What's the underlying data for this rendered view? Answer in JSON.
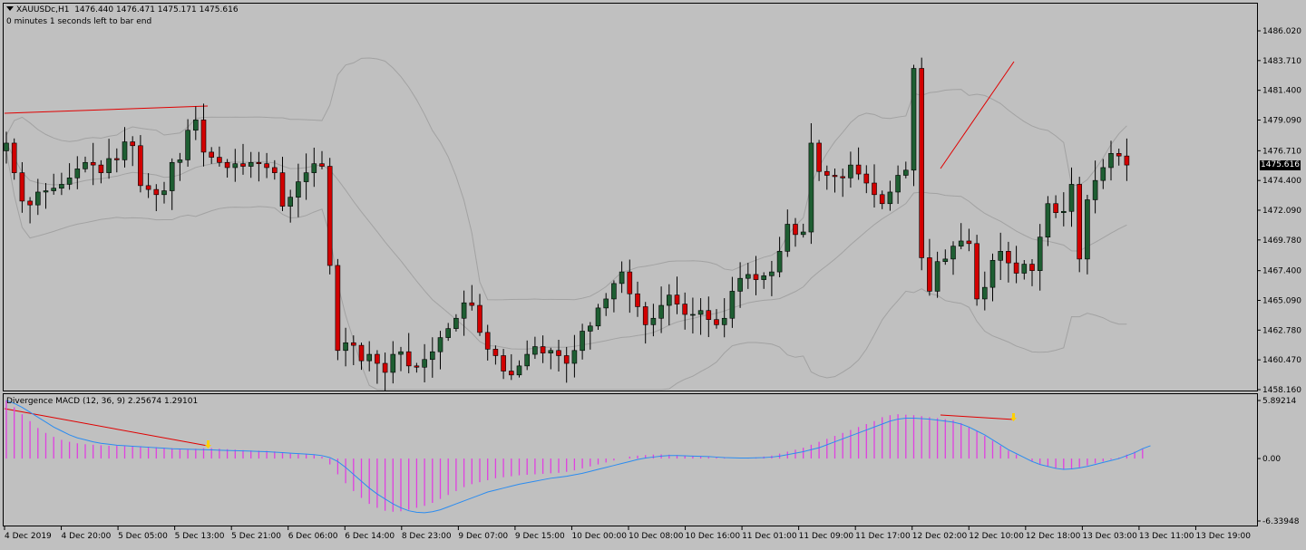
{
  "header": {
    "symbol": "XAUUSDc,H1",
    "ohlc": "1476.440 1476.471 1475.171 1475.616",
    "timer": "0 minutes 1 seconds left to bar end",
    "dropdown_icon": "triangle-down-icon"
  },
  "colors": {
    "background": "#c0c0c0",
    "bull_candle": "#1e5e32",
    "bear_candle": "#d20000",
    "bands": "#a2a2a2",
    "trendline": "#e00000",
    "macd_hist": "#e040e0",
    "macd_signal": "#2b8cf0",
    "arrow": "#ffd000"
  },
  "chart_data": [
    {
      "type": "candlestick",
      "title": "XAUUSDc,H1",
      "current_price": "1475.616",
      "ylim": [
        1458.16,
        1487.5
      ],
      "y_tick_labels": [
        "1486.020",
        "1483.710",
        "1481.400",
        "1479.090",
        "1476.710",
        "1474.400",
        "1472.090",
        "1469.780",
        "1467.400",
        "1465.090",
        "1462.780",
        "1460.470",
        "1458.160"
      ],
      "x_tick_labels": [
        "4 Dec 2019",
        "4 Dec 20:00",
        "5 Dec 05:00",
        "5 Dec 13:00",
        "5 Dec 21:00",
        "6 Dec 06:00",
        "6 Dec 14:00",
        "8 Dec 23:00",
        "9 Dec 07:00",
        "9 Dec 15:00",
        "10 Dec 00:00",
        "10 Dec 08:00",
        "10 Dec 16:00",
        "11 Dec 01:00",
        "11 Dec 09:00",
        "11 Dec 17:00",
        "12 Dec 02:00",
        "12 Dec 10:00",
        "12 Dec 18:00",
        "13 Dec 03:00",
        "13 Dec 11:00",
        "13 Dec 19:00"
      ],
      "series_close": [
        1477.3,
        1475.0,
        1472.8,
        1472.5,
        1473.5,
        1473.6,
        1473.8,
        1474.1,
        1474.6,
        1475.3,
        1475.8,
        1475.6,
        1475.0,
        1476.1,
        1476.0,
        1477.4,
        1477.1,
        1474.0,
        1473.7,
        1473.3,
        1473.6,
        1475.8,
        1476.0,
        1478.3,
        1479.1,
        1476.6,
        1476.2,
        1475.8,
        1475.4,
        1475.7,
        1475.5,
        1475.8,
        1475.7,
        1475.4,
        1475.0,
        1472.4,
        1473.1,
        1474.3,
        1475.0,
        1475.7,
        1475.5,
        1467.8,
        1461.2,
        1461.8,
        1461.6,
        1460.4,
        1460.9,
        1460.2,
        1459.5,
        1460.9,
        1461.1,
        1460.0,
        1459.9,
        1460.5,
        1461.1,
        1462.2,
        1462.9,
        1463.7,
        1464.9,
        1464.7,
        1462.6,
        1461.3,
        1460.8,
        1459.6,
        1459.3,
        1460.0,
        1460.9,
        1461.5,
        1461.0,
        1461.2,
        1460.8,
        1460.2,
        1461.2,
        1462.7,
        1463.1,
        1464.5,
        1465.2,
        1466.4,
        1467.3,
        1465.6,
        1464.6,
        1463.2,
        1463.7,
        1464.7,
        1465.5,
        1464.8,
        1464.0,
        1464.0,
        1464.3,
        1463.6,
        1463.2,
        1463.7,
        1465.8,
        1466.8,
        1467.1,
        1466.7,
        1467.0,
        1467.3,
        1468.9,
        1471.0,
        1470.2,
        1470.4,
        1477.3,
        1475.1,
        1474.8,
        1474.7,
        1474.6,
        1475.6,
        1474.9,
        1474.2,
        1473.3,
        1472.6,
        1473.5,
        1474.8,
        1475.2,
        1483.1,
        1468.4,
        1465.8,
        1468.1,
        1468.3,
        1469.3,
        1469.7,
        1469.5,
        1465.2,
        1466.1,
        1468.2,
        1468.9,
        1468.0,
        1467.2,
        1467.9,
        1467.4,
        1470.0,
        1472.6,
        1471.9,
        1472.0,
        1474.1,
        1468.3,
        1472.9,
        1474.4,
        1475.4,
        1476.5,
        1476.3,
        1475.6
      ],
      "macd_histogram_range": [
        -6.33948,
        5.89214
      ]
    },
    {
      "type": "bar+line",
      "title": "Divergence MACD (12, 36, 9) 2.25674 1.29101",
      "ylim": [
        -6.33948,
        5.89214
      ],
      "y_tick_labels": [
        "5.89214",
        "0.00",
        "-6.33948"
      ],
      "series": [
        {
          "name": "MACD",
          "values": [
            5.9,
            5.2,
            4.5,
            3.8,
            3.1,
            2.6,
            2.2,
            1.9,
            1.7,
            1.55,
            1.45,
            1.4,
            1.35,
            1.3,
            1.3,
            1.3,
            1.28,
            1.25,
            1.2,
            1.15,
            1.1,
            1.05,
            1.0,
            0.95,
            1.0,
            1.05,
            1.05,
            1.0,
            0.95,
            0.9,
            0.85,
            0.82,
            0.8,
            0.78,
            0.72,
            0.6,
            0.5,
            0.45,
            0.42,
            0.4,
            0.2,
            -0.6,
            -1.6,
            -2.5,
            -3.3,
            -4.0,
            -4.6,
            -5.0,
            -5.3,
            -5.4,
            -5.35,
            -5.2,
            -5.0,
            -4.8,
            -4.5,
            -4.1,
            -3.7,
            -3.3,
            -2.9,
            -2.6,
            -2.4,
            -2.2,
            -2.0,
            -1.9,
            -1.8,
            -1.7,
            -1.65,
            -1.6,
            -1.55,
            -1.5,
            -1.45,
            -1.35,
            -1.2,
            -1.0,
            -0.8,
            -0.6,
            -0.4,
            -0.2,
            0.0,
            0.2,
            0.3,
            0.35,
            0.4,
            0.42,
            0.4,
            0.35,
            0.3,
            0.25,
            0.2,
            0.15,
            0.1,
            0.05,
            0.0,
            0.0,
            0.05,
            0.1,
            0.2,
            0.3,
            0.5,
            0.7,
            0.9,
            1.1,
            1.4,
            1.7,
            2.0,
            2.3,
            2.6,
            2.9,
            3.2,
            3.5,
            3.8,
            4.2,
            4.4,
            4.5,
            4.45,
            4.4,
            4.3,
            4.2,
            4.1,
            4.0,
            3.9,
            3.6,
            3.2,
            2.8,
            2.3,
            1.8,
            1.3,
            0.8,
            0.4,
            0.0,
            -0.3,
            -0.6,
            -0.8,
            -1.0,
            -1.1,
            -1.05,
            -0.9,
            -0.7,
            -0.5,
            -0.3,
            -0.1,
            0.1,
            0.4,
            0.7,
            1.0
          ]
        },
        {
          "name": "Signal",
          "values": [
            5.9,
            5.6,
            5.2,
            4.7,
            4.2,
            3.7,
            3.2,
            2.8,
            2.4,
            2.1,
            1.9,
            1.7,
            1.55,
            1.45,
            1.35,
            1.3,
            1.25,
            1.2,
            1.15,
            1.1,
            1.05,
            1.0,
            0.97,
            0.95,
            0.93,
            0.9,
            0.88,
            0.85,
            0.82,
            0.8,
            0.78,
            0.75,
            0.72,
            0.7,
            0.65,
            0.6,
            0.55,
            0.5,
            0.45,
            0.4,
            0.3,
            0.1,
            -0.3,
            -0.9,
            -1.6,
            -2.3,
            -3.0,
            -3.6,
            -4.1,
            -4.6,
            -5.0,
            -5.3,
            -5.45,
            -5.5,
            -5.4,
            -5.2,
            -4.9,
            -4.6,
            -4.3,
            -4.0,
            -3.7,
            -3.4,
            -3.2,
            -3.0,
            -2.8,
            -2.6,
            -2.45,
            -2.3,
            -2.15,
            -2.0,
            -1.9,
            -1.8,
            -1.65,
            -1.5,
            -1.3,
            -1.1,
            -0.9,
            -0.7,
            -0.5,
            -0.3,
            -0.1,
            0.05,
            0.15,
            0.25,
            0.3,
            0.3,
            0.28,
            0.25,
            0.22,
            0.2,
            0.15,
            0.1,
            0.08,
            0.05,
            0.05,
            0.08,
            0.1,
            0.15,
            0.25,
            0.4,
            0.55,
            0.7,
            0.9,
            1.1,
            1.4,
            1.7,
            2.0,
            2.3,
            2.6,
            2.9,
            3.2,
            3.5,
            3.8,
            4.0,
            4.1,
            4.1,
            4.05,
            4.0,
            3.9,
            3.8,
            3.7,
            3.5,
            3.2,
            2.8,
            2.4,
            1.9,
            1.4,
            0.9,
            0.5,
            0.1,
            -0.3,
            -0.6,
            -0.8,
            -1.0,
            -1.1,
            -1.05,
            -0.95,
            -0.8,
            -0.6,
            -0.4,
            -0.2,
            0.0,
            0.3,
            0.6,
            1.0,
            1.3
          ]
        }
      ]
    }
  ]
}
